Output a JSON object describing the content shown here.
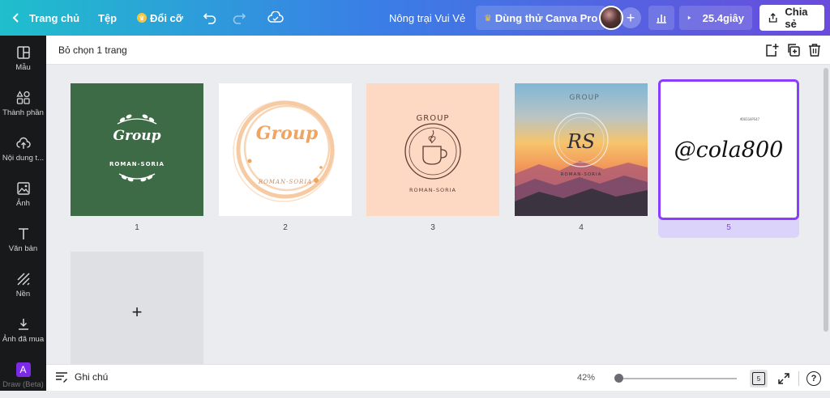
{
  "topbar": {
    "home": "Trang chủ",
    "file": "Tệp",
    "resize": "Đổi cỡ",
    "project_title": "Nông trại Vui Vẻ",
    "try_pro": "Dùng thử Canva Pro",
    "present_time": "25.4giây",
    "share": "Chia sẻ"
  },
  "sidebar": {
    "items": [
      {
        "label": "Mẫu",
        "icon": "template-icon"
      },
      {
        "label": "Thành phần",
        "icon": "elements-icon"
      },
      {
        "label": "Nội dung t...",
        "icon": "upload-icon"
      },
      {
        "label": "Ảnh",
        "icon": "photo-icon"
      },
      {
        "label": "Văn bản",
        "icon": "text-icon"
      },
      {
        "label": "Nền",
        "icon": "background-icon"
      },
      {
        "label": "Ảnh đã mua",
        "icon": "download-icon"
      },
      {
        "label": "Draw (Beta)",
        "icon": "draw-app-icon"
      }
    ]
  },
  "toolbar": {
    "selection": "Bỏ chọn 1 trang"
  },
  "pages": [
    {
      "number": "1",
      "title": "Group",
      "subtitle": "ROMAN-SORIA",
      "bg": "#3d6b45"
    },
    {
      "number": "2",
      "title": "Group",
      "subtitle": "ROMAN-SORIA",
      "bg": "#ffffff"
    },
    {
      "number": "3",
      "title": "GROUP",
      "subtitle": "ROMAN-SORIA",
      "bg": "#fdd9c3"
    },
    {
      "number": "4",
      "title": "GROUP",
      "monogram": "RS",
      "subtitle": "ROMAN-SORIA",
      "bg": "#f0a860"
    },
    {
      "number": "5",
      "small": "#DOIGAPS47",
      "handle": "@cola800",
      "bg": "#ffffff"
    }
  ],
  "add_page": "+",
  "bottombar": {
    "notes": "Ghi chú",
    "zoom": "42%",
    "page_count": "5",
    "help": "?"
  },
  "colors": {
    "accent": "#8b3dff",
    "sidebar_bg": "#18191b",
    "canvas_bg": "#ebecf0"
  }
}
